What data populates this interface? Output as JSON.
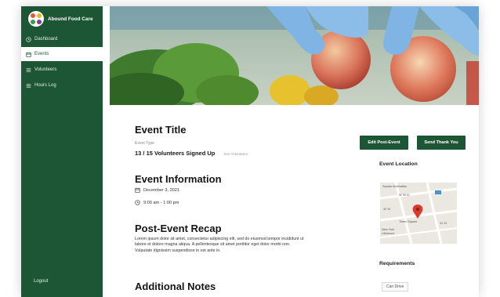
{
  "sidebar": {
    "brand": "Abound Food Care",
    "items": [
      {
        "label": "Dashboard",
        "icon": "clock-icon"
      },
      {
        "label": "Events",
        "icon": "calendar-icon",
        "active": true
      },
      {
        "label": "Volunteers",
        "icon": "list-icon"
      },
      {
        "label": "Hours Log",
        "icon": "list-icon"
      }
    ],
    "logout": "Logout"
  },
  "event": {
    "title": "Event Title",
    "type": "Event Type",
    "signed_up": "13 / 15  Volunteers Signed Up",
    "see_volunteers": "See Volunteers"
  },
  "actions": {
    "edit": "Edit Post-Event",
    "thank": "Send Thank You"
  },
  "info": {
    "heading": "Event Information",
    "date": "December 3, 2021",
    "time": "9:00 am - 1:00 pm"
  },
  "recap": {
    "heading": "Post-Event Recap",
    "text": "Lorem ipsum dolor sit amet, consectetur adipiscing elit, sed do eiusmod tempor incididunt ut labore et dolore magna aliqua. A pellentesque sit amet porttitor eget dolor morbi non. Vulputate dignissim suspendisse in est ante in."
  },
  "notes": {
    "heading": "Additional Notes"
  },
  "location": {
    "heading": "Event Location",
    "map_labels": [
      "Square Manhattan",
      "W 39 St",
      "42 St",
      "Times Square",
      "41 St",
      "New York Lifeinsure"
    ]
  },
  "requirements": {
    "heading": "Requirements",
    "items": [
      "Can Drive"
    ]
  },
  "colors": {
    "brand": "#1c5634",
    "accent_red": "#d93a2b"
  }
}
